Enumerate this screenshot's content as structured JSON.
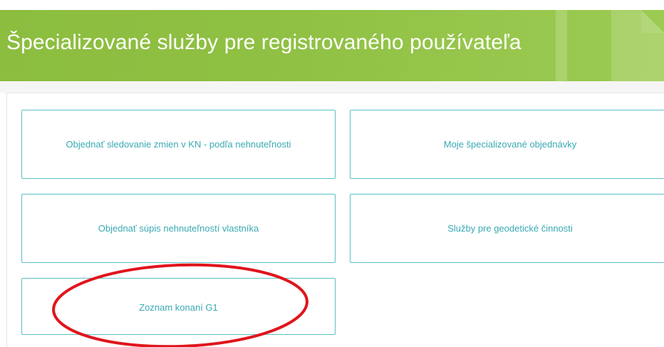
{
  "header": {
    "title": "Špecializované služby pre registrovaného používateľa",
    "background_color": "#8fc043",
    "title_color": "#ffffff"
  },
  "tiles": [
    {
      "label": "Objednať sledovanie zmien v KN - podľa nehnuteľnosti"
    },
    {
      "label": "Moje špecializované objednávky"
    },
    {
      "label": "Objednať súpis nehnuteľností vlastníka"
    },
    {
      "label": "Služby pre geodetické činnosti"
    },
    {
      "label": "Zoznam konaní G1"
    }
  ],
  "colors": {
    "tile_border": "#5bc0c8",
    "tile_text": "#3aa9b4",
    "annotation_ellipse": "#e0151c"
  },
  "annotation": {
    "shape": "ellipse",
    "highlights_tile": "Zoznam konaní G1"
  }
}
